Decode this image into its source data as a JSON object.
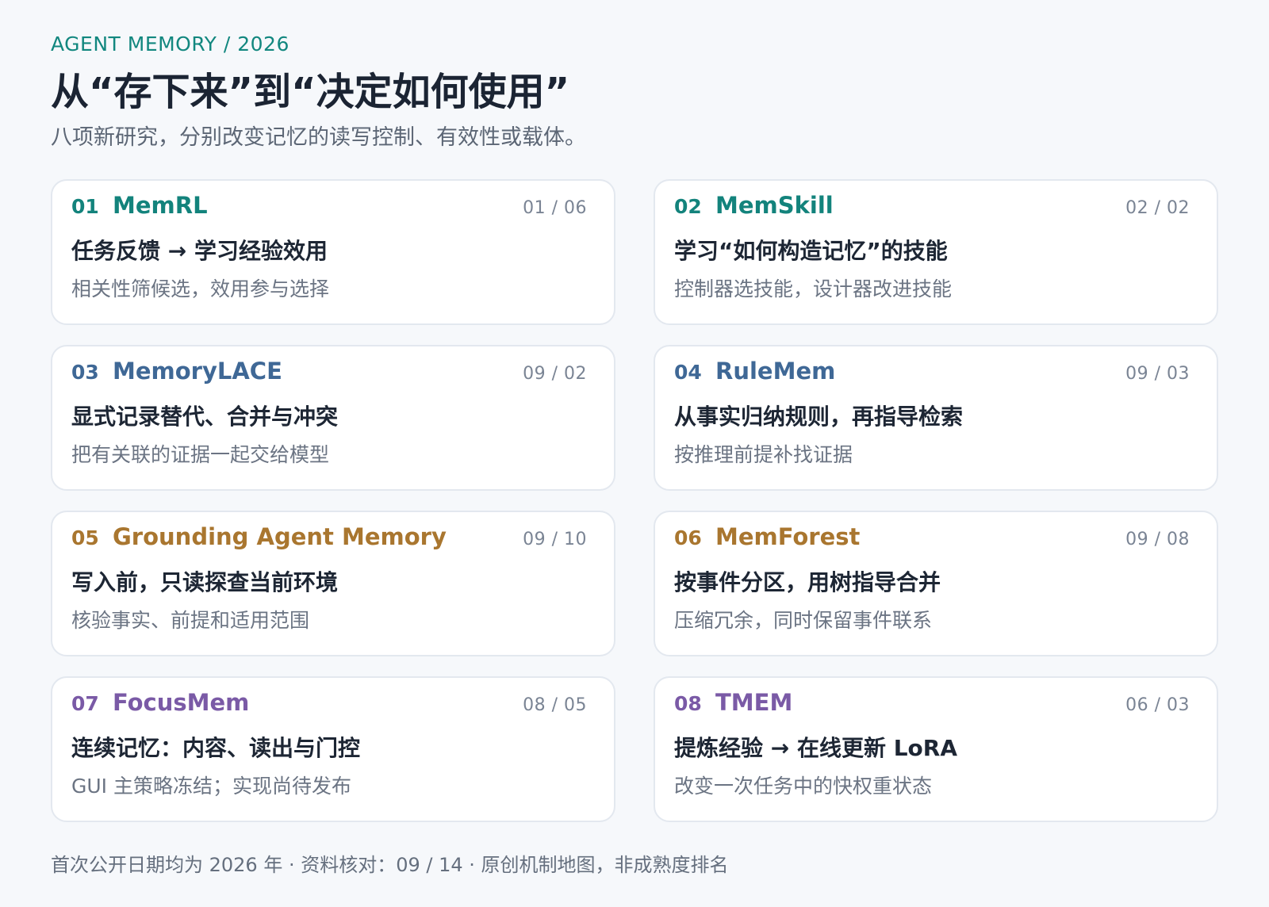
{
  "header": {
    "kicker": "AGENT MEMORY / 2026",
    "title": "从“存下来”到“决定如何使用”",
    "subtitle": "八项新研究，分别改变记忆的读写控制、有效性或载体。"
  },
  "cards": [
    {
      "num": "01",
      "name": "MemRL",
      "date": "01 / 06",
      "headline": "任务反馈 → 学习经验效用",
      "detail": "相关性筛候选，效用参与选择",
      "accent": "#13837c"
    },
    {
      "num": "02",
      "name": "MemSkill",
      "date": "02 / 02",
      "headline": "学习“如何构造记忆”的技能",
      "detail": "控制器选技能，设计器改进技能",
      "accent": "#13837c"
    },
    {
      "num": "03",
      "name": "MemoryLACE",
      "date": "09 / 02",
      "headline": "显式记录替代、合并与冲突",
      "detail": "把有关联的证据一起交给模型",
      "accent": "#3f6896"
    },
    {
      "num": "04",
      "name": "RuleMem",
      "date": "09 / 03",
      "headline": "从事实归纳规则，再指导检索",
      "detail": "按推理前提补找证据",
      "accent": "#3f6896"
    },
    {
      "num": "05",
      "name": "Grounding Agent Memory",
      "date": "09 / 10",
      "headline": "写入前，只读探查当前环境",
      "detail": "核验事实、前提和适用范围",
      "accent": "#a9762f"
    },
    {
      "num": "06",
      "name": "MemForest",
      "date": "09 / 08",
      "headline": "按事件分区，用树指导合并",
      "detail": "压缩冗余，同时保留事件联系",
      "accent": "#a9762f"
    },
    {
      "num": "07",
      "name": "FocusMem",
      "date": "08 / 05",
      "headline": "连续记忆：内容、读出与门控",
      "detail": "GUI 主策略冻结；实现尚待发布",
      "accent": "#7a5aa6"
    },
    {
      "num": "08",
      "name": "TMEM",
      "date": "06 / 03",
      "headline": "提炼经验 → 在线更新 LoRA",
      "detail": "改变一次任务中的快权重状态",
      "accent": "#7a5aa6"
    }
  ],
  "footer": {
    "text": "首次公开日期均为 2026 年 · 资料核对：09 / 14 · 原创机制地图，非成熟度排名"
  }
}
